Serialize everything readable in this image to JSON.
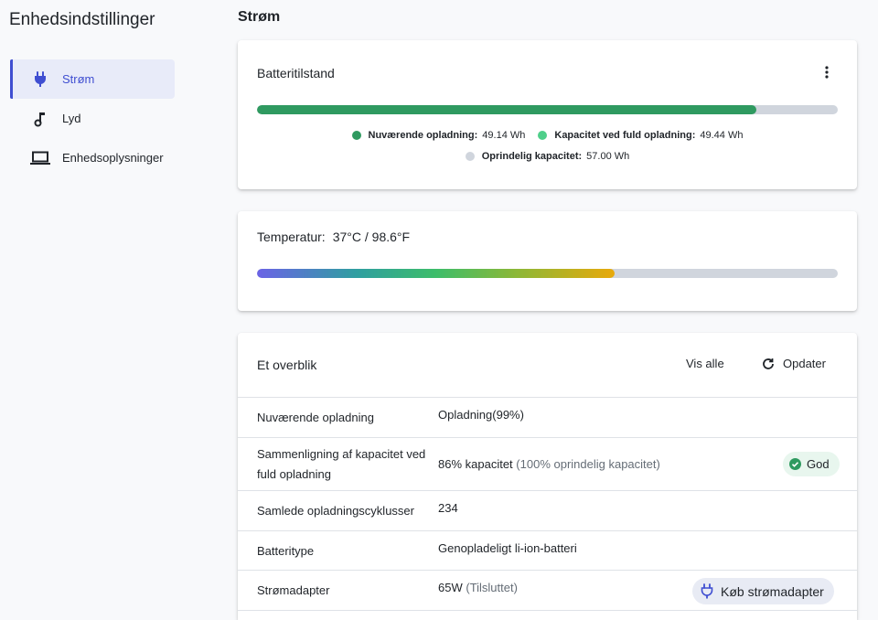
{
  "sidebar": {
    "title": "Enhedsindstillinger",
    "items": [
      {
        "label": "Strøm",
        "icon": "plug-icon",
        "active": true
      },
      {
        "label": "Lyd",
        "icon": "music-note-icon",
        "active": false
      },
      {
        "label": "Enhedsoplysninger",
        "icon": "laptop-icon",
        "active": false
      }
    ]
  },
  "page": {
    "title": "Strøm"
  },
  "battery": {
    "title": "Batteritilstand",
    "menu_icon": "more-vertical-icon",
    "charge_fraction": 0.86,
    "legend": {
      "current": {
        "label": "Nuværende opladning:",
        "value": "49.14 Wh",
        "color": "#2f9a60"
      },
      "full": {
        "label": "Kapacitet ved fuld opladning:",
        "value": "49.44 Wh",
        "color": "#4fcf8a"
      },
      "original": {
        "label": "Oprindelig kapacitet:",
        "value": "57.00 Wh",
        "color": "#d0d5dd"
      }
    }
  },
  "temperature": {
    "label": "Temperatur:",
    "value": "37°C / 98.6°F",
    "level_fraction": 0.615
  },
  "overview": {
    "title": "Et overblik",
    "view_all_label": "Vis alle",
    "refresh_label": "Opdater",
    "rows": {
      "current_charge": {
        "label": "Nuværende opladning",
        "value": "Opladning(99%)"
      },
      "capacity": {
        "label": "Sammenligning af kapacitet ved fuld opladning",
        "value": "86% kapacitet",
        "note": "(100% oprindelig kapacitet)",
        "badge": "God"
      },
      "cycles": {
        "label": "Samlede opladningscyklusser",
        "value": "234"
      },
      "type": {
        "label": "Batteritype",
        "value": "Genopladeligt li-ion-batteri"
      },
      "adapter": {
        "label": "Strømadapter",
        "value": "65W",
        "note": "(Tilsluttet)",
        "button": "Køb strømadapter"
      }
    }
  },
  "colors": {
    "accent": "#3f4ed1",
    "battery_fill": "#2f9a60",
    "good_badge": "#2f9a60"
  }
}
